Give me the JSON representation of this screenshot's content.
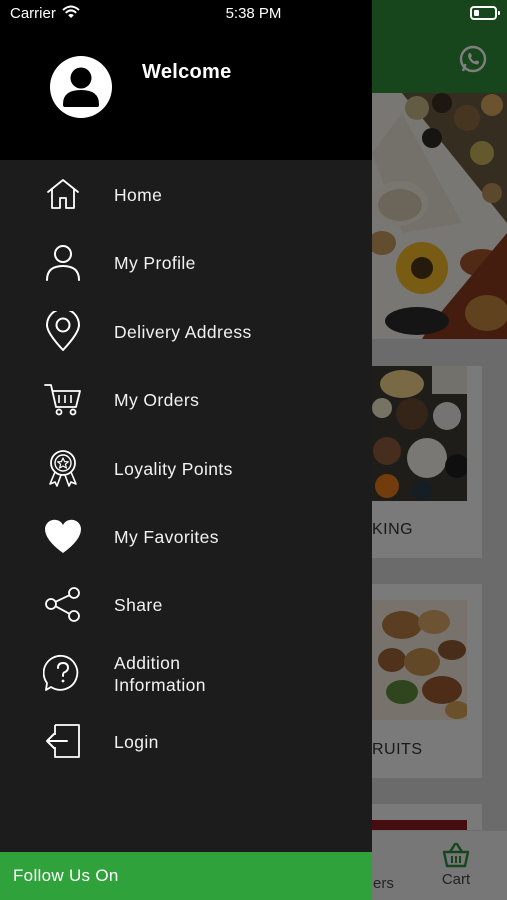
{
  "status_bar": {
    "carrier": "Carrier",
    "time": "5:38 PM"
  },
  "drawer": {
    "welcome": "Welcome",
    "menu": [
      {
        "label": "Home",
        "icon": "home-icon"
      },
      {
        "label": "My Profile",
        "icon": "user-icon"
      },
      {
        "label": "Delivery Address",
        "icon": "location-pin-icon"
      },
      {
        "label": "My Orders",
        "icon": "cart-icon"
      },
      {
        "label": "Loyality Points",
        "icon": "award-badge-icon"
      },
      {
        "label": "My Favorites",
        "icon": "heart-icon"
      },
      {
        "label": "Share",
        "icon": "share-icon"
      },
      {
        "label": "Addition Information",
        "icon": "question-bubble-icon"
      },
      {
        "label": "Login",
        "icon": "login-icon"
      }
    ],
    "follow_us": "Follow Us On"
  },
  "background": {
    "card_1_label": "KING",
    "card_2_label": "RUITS",
    "tab_partial_label": "ers",
    "tab_cart_label": "Cart"
  },
  "colors": {
    "drawer_bg": "#1c1c1c",
    "drawer_header_bg": "#000000",
    "accent_green": "#30a23c",
    "app_header_green": "#2e8b39"
  }
}
